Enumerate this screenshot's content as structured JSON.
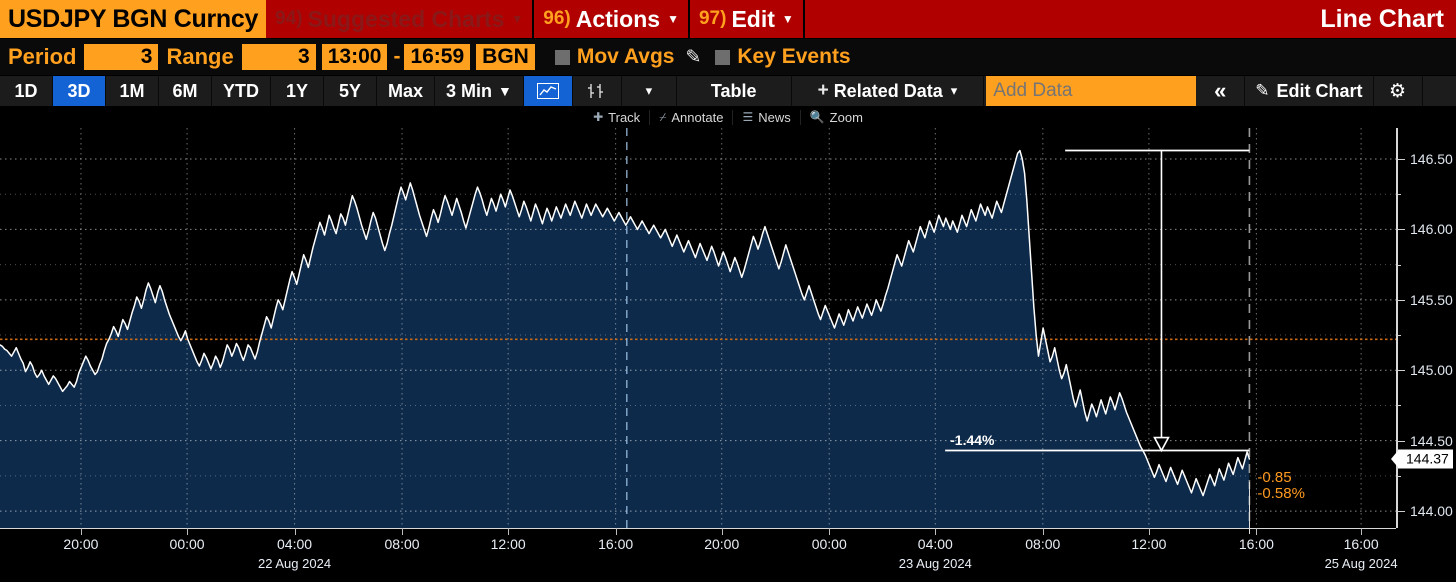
{
  "command_bar": {
    "ticker": "USDJPY BGN Curncy",
    "items": [
      {
        "num": "94)",
        "label": "Suggested Charts",
        "dim": true,
        "caret": true
      },
      {
        "num": "96)",
        "label": "Actions",
        "dim": false,
        "caret": true
      },
      {
        "num": "97)",
        "label": "Edit",
        "dim": false,
        "caret": true
      }
    ],
    "right_label": "Line Chart"
  },
  "period_bar": {
    "period_label": "Period",
    "period_value": "3",
    "range_label": "Range",
    "range_value": "3",
    "time_start": "13:00",
    "time_dash": "-",
    "time_end": "16:59",
    "source": "BGN",
    "mov_avgs_label": "Mov Avgs",
    "pencil_icon": "pencil-icon",
    "key_events_label": "Key Events"
  },
  "tab_bar": {
    "ranges": [
      {
        "label": "1D",
        "selected": false
      },
      {
        "label": "3D",
        "selected": true
      },
      {
        "label": "1M",
        "selected": false
      },
      {
        "label": "6M",
        "selected": false
      },
      {
        "label": "YTD",
        "selected": false
      },
      {
        "label": "1Y",
        "selected": false
      },
      {
        "label": "5Y",
        "selected": false
      },
      {
        "label": "Max",
        "selected": false
      }
    ],
    "interval": "3 Min",
    "interval_caret": "▼",
    "line_chart_icon": "line-chart-icon",
    "bar_chart_icon": "bar-chart-icon",
    "more_caret": "▾",
    "table_label": "Table",
    "related_data_label": "Related Data",
    "related_caret": "▾",
    "add_data_placeholder": "Add Data",
    "collapse_icon": "«",
    "edit_chart_label": "Edit Chart",
    "gear_icon": "gear-icon"
  },
  "track_bar": {
    "items": [
      {
        "icon": "track-icon",
        "label": "Track"
      },
      {
        "icon": "annotate-icon",
        "label": "Annotate"
      },
      {
        "icon": "news-icon",
        "label": "News"
      },
      {
        "icon": "zoom-icon",
        "label": "Zoom"
      }
    ]
  },
  "colors": {
    "brand_red": "#b00000",
    "accent_orange": "#ffa01e",
    "selected_blue": "#1463d4",
    "area_fill": "#0d2a4a",
    "line_white": "#ffffff",
    "ref_line_orange": "#c86a16"
  },
  "chart_data": {
    "type": "line",
    "title": "USDJPY BGN Curncy",
    "subtitle": "Line Chart",
    "xlabel": "",
    "ylabel": "",
    "ylim": [
      143.88,
      146.72
    ],
    "grid": true,
    "legend": "none",
    "y_ticks": [
      {
        "value": 146.5,
        "label": "146.50"
      },
      {
        "value": 146.0,
        "label": "146.00"
      },
      {
        "value": 145.5,
        "label": "145.50"
      },
      {
        "value": 145.0,
        "label": "145.00"
      },
      {
        "value": 144.5,
        "label": "144.50"
      },
      {
        "value": 144.0,
        "label": "144.00"
      }
    ],
    "y_minor_ticks": [
      146.25,
      145.75,
      145.25,
      144.75,
      144.25
    ],
    "x_ticks": [
      {
        "pos": 0.058,
        "label": "20:00",
        "date": ""
      },
      {
        "pos": 0.134,
        "label": "00:00",
        "date": ""
      },
      {
        "pos": 0.211,
        "label": "04:00",
        "date": "22 Aug 2024"
      },
      {
        "pos": 0.288,
        "label": "08:00",
        "date": ""
      },
      {
        "pos": 0.364,
        "label": "12:00",
        "date": ""
      },
      {
        "pos": 0.441,
        "label": "16:00",
        "date": ""
      },
      {
        "pos": 0.517,
        "label": "20:00",
        "date": ""
      },
      {
        "pos": 0.594,
        "label": "00:00",
        "date": ""
      },
      {
        "pos": 0.67,
        "label": "04:00",
        "date": "23 Aug 2024"
      },
      {
        "pos": 0.747,
        "label": "08:00",
        "date": ""
      },
      {
        "pos": 0.823,
        "label": "12:00",
        "date": ""
      },
      {
        "pos": 0.9,
        "label": "16:00",
        "date": ""
      },
      {
        "pos": 0.975,
        "label": "16:00",
        "date": "25 Aug 2024"
      }
    ],
    "last_price": "144.37",
    "last_price_value": 144.37,
    "change_abs": "-0.85",
    "change_pct": "-0.58%",
    "reference_level": 145.22,
    "annotation": {
      "label": "-1.44%",
      "from_value": 146.56,
      "to_value": 144.43,
      "from_x": 0.763,
      "to_x": 0.832
    },
    "day_divider_x": 0.449,
    "end_divider_x": 0.895,
    "series_name": "USDJPY",
    "values": [
      145.18,
      145.17,
      145.15,
      145.14,
      145.12,
      145.1,
      145.13,
      145.16,
      145.12,
      145.08,
      145.05,
      144.99,
      145.02,
      145.06,
      145.03,
      144.98,
      144.95,
      144.97,
      145.0,
      144.96,
      144.93,
      144.9,
      144.93,
      144.96,
      144.94,
      144.91,
      144.88,
      144.85,
      144.87,
      144.89,
      144.92,
      144.9,
      144.88,
      144.92,
      144.98,
      145.02,
      145.06,
      145.1,
      145.07,
      145.03,
      145.0,
      144.97,
      144.99,
      145.04,
      145.08,
      145.14,
      145.19,
      145.22,
      145.26,
      145.31,
      145.28,
      145.24,
      145.3,
      145.36,
      145.33,
      145.29,
      145.35,
      145.41,
      145.46,
      145.52,
      145.49,
      145.44,
      145.5,
      145.57,
      145.62,
      145.58,
      145.53,
      145.48,
      145.55,
      145.6,
      145.56,
      145.5,
      145.45,
      145.4,
      145.36,
      145.32,
      145.28,
      145.24,
      145.21,
      145.24,
      145.28,
      145.22,
      145.18,
      145.14,
      145.1,
      145.06,
      145.03,
      145.07,
      145.12,
      145.09,
      145.05,
      145.01,
      145.05,
      145.1,
      145.07,
      145.02,
      145.06,
      145.12,
      145.18,
      145.15,
      145.1,
      145.14,
      145.19,
      145.16,
      145.11,
      145.07,
      145.12,
      145.18,
      145.16,
      145.12,
      145.08,
      145.13,
      145.2,
      145.26,
      145.32,
      145.38,
      145.35,
      145.3,
      145.37,
      145.44,
      145.5,
      145.47,
      145.43,
      145.5,
      145.57,
      145.64,
      145.7,
      145.66,
      145.61,
      145.68,
      145.75,
      145.82,
      145.78,
      145.73,
      145.8,
      145.87,
      145.93,
      145.99,
      146.05,
      146.01,
      145.96,
      146.03,
      146.1,
      146.06,
      146.01,
      145.97,
      146.04,
      146.11,
      146.08,
      146.03,
      146.1,
      146.17,
      146.24,
      146.2,
      146.15,
      146.09,
      146.03,
      145.98,
      145.93,
      145.99,
      146.06,
      146.12,
      146.08,
      146.02,
      145.96,
      145.9,
      145.85,
      145.9,
      145.97,
      146.03,
      146.1,
      146.17,
      146.24,
      146.3,
      146.26,
      146.21,
      146.27,
      146.33,
      146.28,
      146.22,
      146.16,
      146.1,
      146.05,
      146.0,
      145.95,
      146.01,
      146.08,
      146.14,
      146.1,
      146.05,
      146.11,
      146.18,
      146.24,
      146.2,
      146.15,
      146.1,
      146.16,
      146.22,
      146.17,
      146.12,
      146.06,
      146.01,
      146.07,
      146.13,
      146.19,
      146.25,
      146.3,
      146.26,
      146.21,
      146.15,
      146.1,
      146.16,
      146.22,
      146.18,
      146.13,
      146.19,
      146.25,
      146.21,
      146.16,
      146.22,
      146.28,
      146.24,
      146.19,
      146.14,
      146.09,
      146.14,
      146.2,
      146.16,
      146.11,
      146.06,
      146.12,
      146.18,
      146.14,
      146.09,
      146.04,
      146.1,
      146.15,
      146.11,
      146.06,
      146.11,
      146.16,
      146.12,
      146.08,
      146.13,
      146.18,
      146.14,
      146.1,
      146.15,
      146.2,
      146.16,
      146.12,
      146.08,
      146.13,
      146.18,
      146.14,
      146.1,
      146.14,
      146.18,
      146.15,
      146.12,
      146.09,
      146.12,
      146.15,
      146.12,
      146.09,
      146.06,
      146.09,
      146.12,
      146.09,
      146.06,
      146.03,
      146.06,
      146.09,
      146.06,
      146.03,
      146.0,
      146.03,
      146.06,
      146.03,
      146.0,
      145.97,
      146.0,
      146.03,
      146.0,
      145.97,
      145.94,
      145.97,
      146.0,
      145.96,
      145.92,
      145.88,
      145.92,
      145.96,
      145.92,
      145.88,
      145.84,
      145.88,
      145.92,
      145.88,
      145.84,
      145.8,
      145.85,
      145.9,
      145.86,
      145.82,
      145.78,
      145.83,
      145.88,
      145.84,
      145.79,
      145.74,
      145.79,
      145.84,
      145.8,
      145.75,
      145.7,
      145.75,
      145.8,
      145.76,
      145.71,
      145.66,
      145.71,
      145.77,
      145.83,
      145.89,
      145.95,
      145.91,
      145.86,
      145.91,
      145.97,
      146.02,
      145.97,
      145.92,
      145.87,
      145.82,
      145.77,
      145.72,
      145.77,
      145.83,
      145.89,
      145.84,
      145.79,
      145.74,
      145.69,
      145.64,
      145.59,
      145.54,
      145.5,
      145.55,
      145.6,
      145.55,
      145.5,
      145.45,
      145.4,
      145.36,
      145.41,
      145.46,
      145.42,
      145.38,
      145.34,
      145.3,
      145.35,
      145.4,
      145.36,
      145.32,
      145.37,
      145.43,
      145.39,
      145.35,
      145.4,
      145.45,
      145.41,
      145.37,
      145.42,
      145.47,
      145.43,
      145.39,
      145.44,
      145.5,
      145.46,
      145.42,
      145.47,
      145.53,
      145.58,
      145.64,
      145.7,
      145.76,
      145.82,
      145.78,
      145.74,
      145.8,
      145.86,
      145.92,
      145.88,
      145.84,
      145.9,
      145.96,
      146.02,
      145.98,
      145.94,
      146.0,
      146.06,
      146.02,
      145.98,
      146.04,
      146.1,
      146.06,
      146.02,
      146.08,
      146.04,
      146.0,
      146.06,
      146.02,
      145.98,
      146.04,
      146.1,
      146.06,
      146.02,
      146.08,
      146.14,
      146.1,
      146.06,
      146.12,
      146.18,
      146.14,
      146.1,
      146.16,
      146.12,
      146.08,
      146.14,
      146.2,
      146.16,
      146.12,
      146.18,
      146.24,
      146.3,
      146.36,
      146.42,
      146.48,
      146.54,
      146.56,
      146.5,
      146.4,
      146.2,
      145.95,
      145.7,
      145.45,
      145.25,
      145.1,
      145.2,
      145.3,
      145.22,
      145.14,
      145.06,
      145.1,
      145.16,
      145.08,
      145.0,
      144.94,
      144.98,
      145.04,
      144.96,
      144.88,
      144.8,
      144.74,
      144.8,
      144.86,
      144.78,
      144.7,
      144.64,
      144.7,
      144.76,
      144.72,
      144.67,
      144.73,
      144.79,
      144.74,
      144.69,
      144.75,
      144.81,
      144.77,
      144.72,
      144.78,
      144.84,
      144.8,
      144.75,
      144.7,
      144.66,
      144.62,
      144.58,
      144.54,
      144.5,
      144.46,
      144.43,
      144.4,
      144.36,
      144.32,
      144.28,
      144.24,
      144.28,
      144.33,
      144.29,
      144.25,
      144.21,
      144.26,
      144.31,
      144.27,
      144.23,
      144.19,
      144.24,
      144.29,
      144.25,
      144.21,
      144.17,
      144.13,
      144.18,
      144.23,
      144.19,
      144.15,
      144.11,
      144.16,
      144.21,
      144.26,
      144.22,
      144.18,
      144.24,
      144.3,
      144.26,
      144.22,
      144.28,
      144.34,
      144.3,
      144.26,
      144.32,
      144.38,
      144.34,
      144.3,
      144.36,
      144.42,
      144.37
    ]
  }
}
